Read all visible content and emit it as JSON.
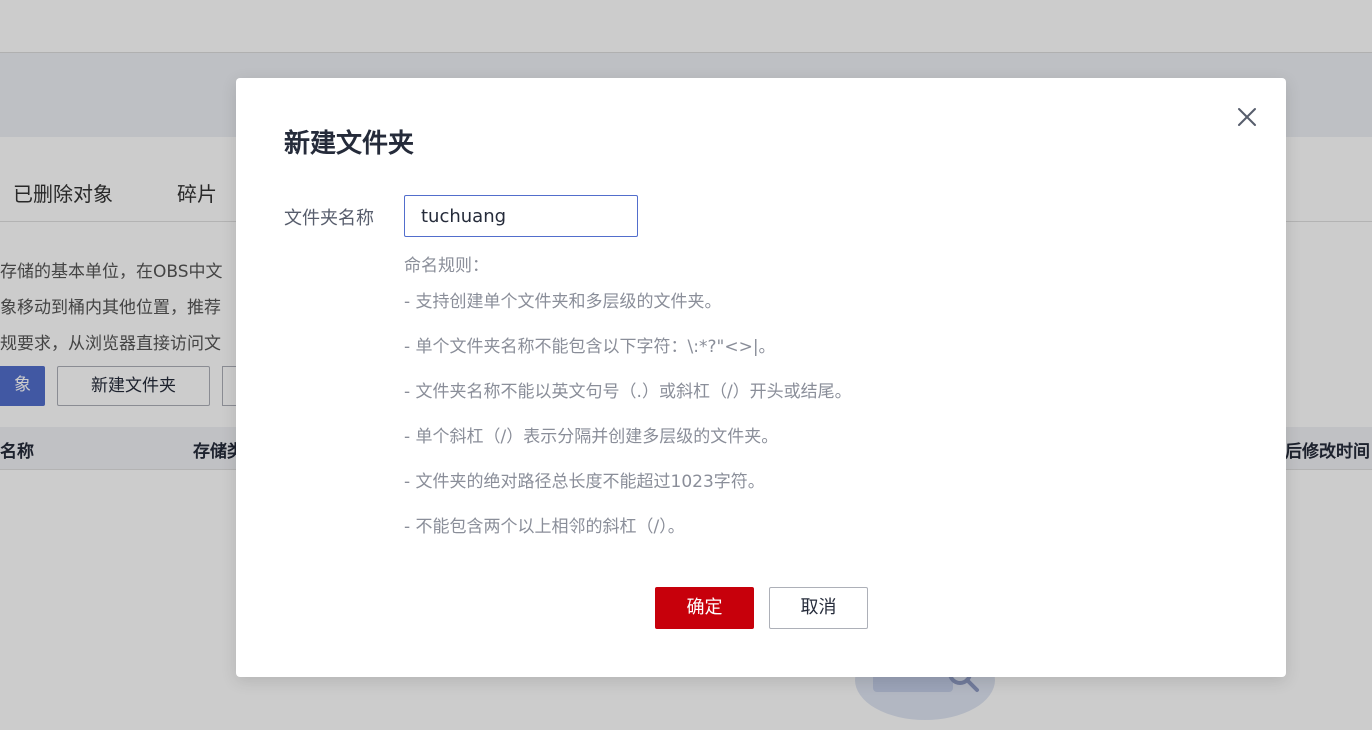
{
  "background": {
    "tabs": [
      "已删除对象",
      "碎片"
    ],
    "description_lines": [
      "存储的基本单位，在OBS中文",
      "象移动到桶内其他位置，推荐",
      "规要求，从浏览器直接访问文"
    ],
    "buttons": {
      "upload_partial": "象",
      "new_folder": "新建文件夹"
    },
    "table_columns": [
      "名称",
      "存储类",
      "后修改时间"
    ]
  },
  "dialog": {
    "title": "新建文件夹",
    "field_label": "文件夹名称",
    "input_value": "tuchuang",
    "rules_title": "命名规则：",
    "rules": [
      "- 支持创建单个文件夹和多层级的文件夹。",
      "- 单个文件夹名称不能包含以下字符：\\:*?\"<>|。",
      "- 文件夹名称不能以英文句号（.）或斜杠（/）开头或结尾。",
      "- 单个斜杠（/）表示分隔并创建多层级的文件夹。",
      "- 文件夹的绝对路径总长度不能超过1023字符。",
      "- 不能包含两个以上相邻的斜杠（/）。"
    ],
    "confirm_label": "确定",
    "cancel_label": "取消"
  },
  "colors": {
    "primary_red": "#c7000b",
    "input_border": "#526ecc",
    "overlay": "rgba(0,0,0,0.2)"
  },
  "icons": {
    "close": "close-icon",
    "empty": "empty-state-illustration"
  }
}
